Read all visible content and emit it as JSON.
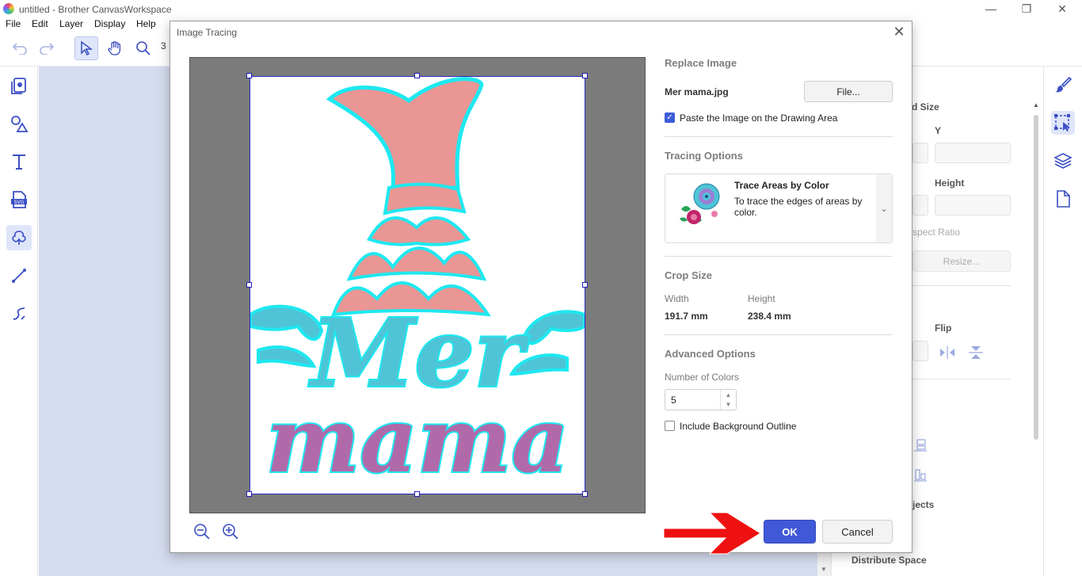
{
  "window": {
    "title": "untitled - Brother CanvasWorkspace"
  },
  "menu": [
    "File",
    "Edit",
    "Layer",
    "Display",
    "Help"
  ],
  "toolbar": {
    "zoom_value": "3"
  },
  "right_panel": {
    "size_title": "d Size",
    "y_label": "Y",
    "height_label": "Height",
    "aspect_label": "spect Ratio",
    "resize_label": "Resize...",
    "flip_label": "Flip",
    "objects_label": "jects",
    "distribute_label": "Distribute Space"
  },
  "dialog": {
    "title": "Image Tracing",
    "replace_image": {
      "heading": "Replace Image",
      "filename": "Mer mama.jpg",
      "file_button": "File...",
      "paste_label": "Paste the Image on the Drawing Area",
      "paste_checked": true
    },
    "tracing_options": {
      "heading": "Tracing Options",
      "mode_title": "Trace Areas by Color",
      "mode_desc": "To trace the edges of areas by color."
    },
    "crop_size": {
      "heading": "Crop Size",
      "width_label": "Width",
      "height_label": "Height",
      "width_value": "191.7 mm",
      "height_value": "238.4 mm"
    },
    "advanced": {
      "heading": "Advanced Options",
      "colors_label": "Number of Colors",
      "colors_value": "5",
      "bg_outline_label": "Include Background Outline",
      "bg_outline_checked": false
    },
    "ok_label": "OK",
    "cancel_label": "Cancel"
  },
  "preview_image": {
    "text_line1": "Mer",
    "text_line2": "mama"
  },
  "colors": {
    "accent": "#4059d8",
    "tail_pink": "#e99694",
    "text_blue": "#4fc4d6",
    "text_purple": "#b06aaa",
    "outline_cyan": "#1ee8f0",
    "arrow_red": "#ee1111"
  }
}
